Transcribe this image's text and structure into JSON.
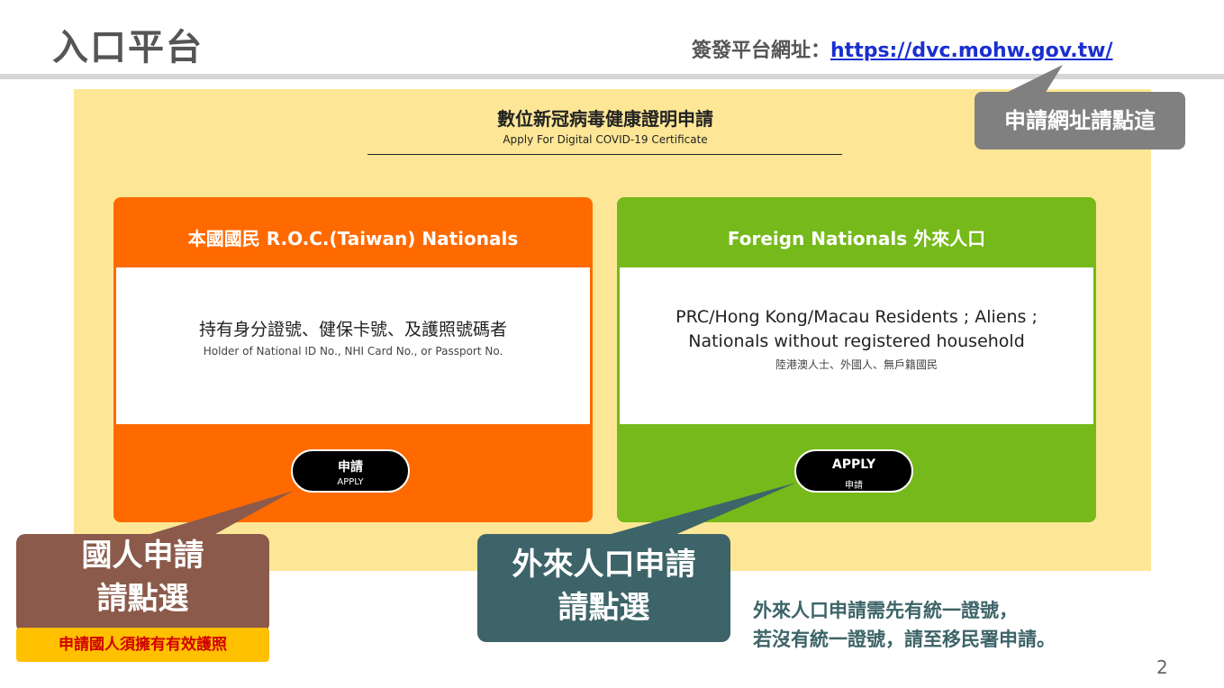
{
  "slide": {
    "title": "入口平台",
    "url_label": "簽發平台網址：",
    "url": "https://dvc.mohw.gov.tw/",
    "page_number": "2"
  },
  "panel": {
    "title": "數位新冠病毒健康證明申請",
    "subtitle": "Apply For Digital COVID-19 Certificate"
  },
  "cards": {
    "roc": {
      "header": "本國國民 R.O.C.(Taiwan) Nationals",
      "main": "持有身分證號、健保卡號、及護照號碼者",
      "sub": "Holder of National ID No., NHI Card No., or Passport No.",
      "button_line1": "申請",
      "button_line2": "APPLY",
      "color": "#ff6a00"
    },
    "foreign": {
      "header": "Foreign Nationals 外來人口",
      "main_line1": "PRC/Hong Kong/Macau Residents ; Aliens ;",
      "main_line2": "Nationals without registered household",
      "sub": "陸港澳人士、外國人、無戶籍國民",
      "button_line1": "APPLY",
      "button_line2": "申請",
      "color": "#76b91a"
    }
  },
  "callouts": {
    "top": "申請網址請點這",
    "roc_line1": "國人申請",
    "roc_line2": "請點選",
    "passport_note": "申請國人須擁有有效護照",
    "foreign_line1": "外來人口申請",
    "foreign_line2": "請點選",
    "foreign_note_line1": "外來人口申請需先有統一證號，",
    "foreign_note_line2": "若沒有統一證號，請至移民署申請。"
  }
}
